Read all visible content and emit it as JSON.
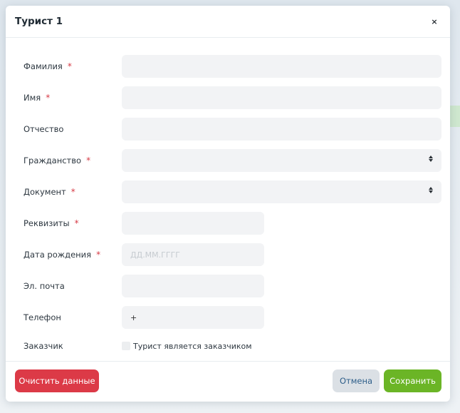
{
  "modal": {
    "title": "Турист 1",
    "close_icon": "close-icon",
    "close_glyph": "×"
  },
  "required_mark": "*",
  "fields": {
    "surname": {
      "label": "Фамилия",
      "required": true,
      "value": ""
    },
    "name": {
      "label": "Имя",
      "required": true,
      "value": ""
    },
    "patronymic": {
      "label": "Отчество",
      "required": false,
      "value": ""
    },
    "citizenship": {
      "label": "Гражданство",
      "required": true,
      "value": ""
    },
    "document": {
      "label": "Документ",
      "required": true,
      "value": ""
    },
    "requisites": {
      "label": "Реквизиты",
      "required": true,
      "value": ""
    },
    "birthdate": {
      "label": "Дата рождения",
      "required": true,
      "value": "",
      "placeholder": "ДД.ММ.ГГГГ"
    },
    "email": {
      "label": "Эл. почта",
      "required": false,
      "value": ""
    },
    "phone": {
      "label": "Телефон",
      "required": false,
      "value": "+"
    },
    "customer": {
      "label": "Заказчик",
      "checkbox_label": "Турист является заказчиком",
      "checked": false
    }
  },
  "footer": {
    "clear_label": "Очистить данные",
    "cancel_label": "Отмена",
    "save_label": "Сохранить"
  },
  "colors": {
    "danger": "#dc3a47",
    "success": "#6bb526",
    "secondary": "#dbe0e5",
    "field_bg": "#f2f3f5"
  }
}
